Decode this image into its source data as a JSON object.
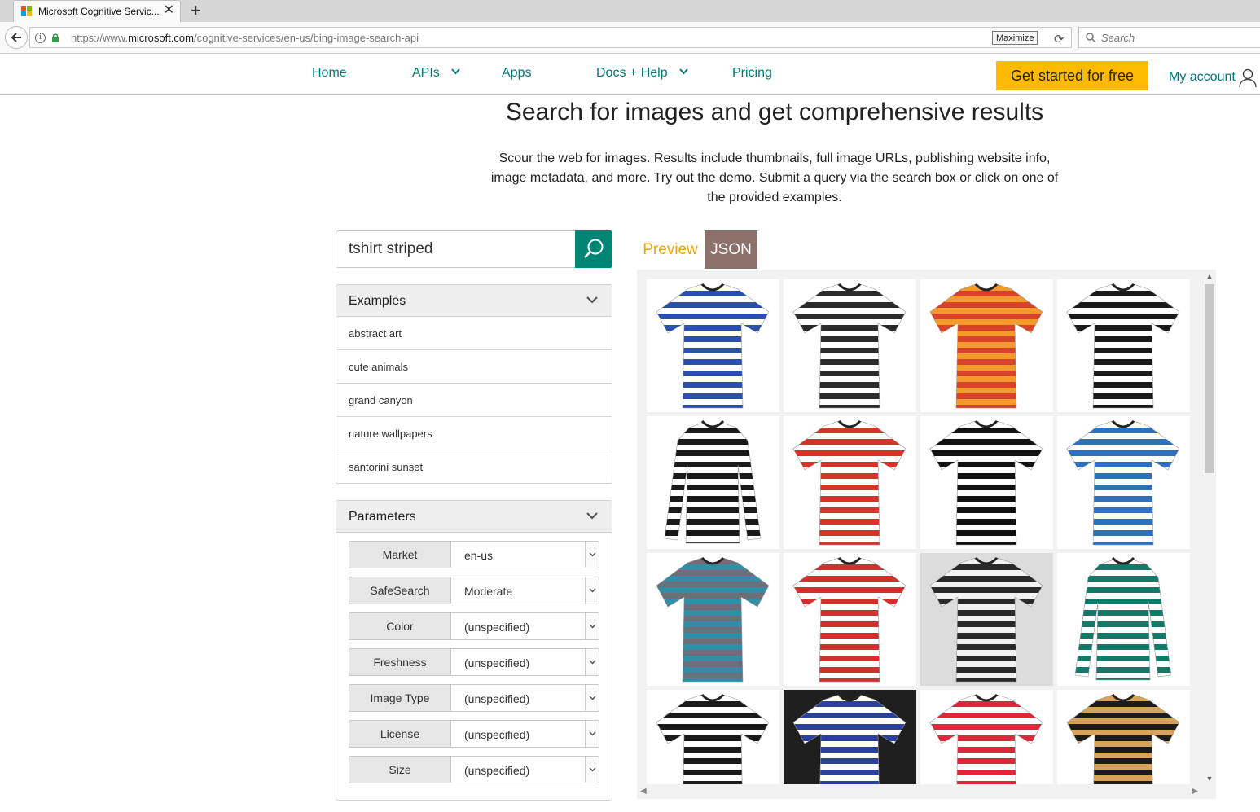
{
  "browser": {
    "tab_title": "Microsoft Cognitive Servic...",
    "new_tab_symbol": "+",
    "close_symbol": "✕",
    "url_prefix": "https://www.",
    "url_domain": "microsoft.com",
    "url_path": "/cognitive-services/en-us/bing-image-search-api",
    "tooltip": "Maximize",
    "search_placeholder": "Search"
  },
  "nav": {
    "home": "Home",
    "apis": "APIs",
    "apps": "Apps",
    "docs": "Docs + Help",
    "pricing": "Pricing",
    "cta": "Get started for free",
    "account": "My account"
  },
  "hero": {
    "title": "Search for images and get comprehensive results",
    "description": "Scour the web for images. Results include thumbnails, full image URLs, publishing website info, image metadata, and more. Try out the demo. Submit a query via the search box or click on one of the provided examples."
  },
  "query": {
    "value": "tshirt striped"
  },
  "examples": {
    "heading": "Examples",
    "items": [
      "abstract art",
      "cute animals",
      "grand canyon",
      "nature wallpapers",
      "santorini sunset"
    ]
  },
  "parameters": {
    "heading": "Parameters",
    "rows": [
      {
        "label": "Market",
        "value": "en-us"
      },
      {
        "label": "SafeSearch",
        "value": "Moderate"
      },
      {
        "label": "Color",
        "value": "(unspecified)"
      },
      {
        "label": "Freshness",
        "value": "(unspecified)"
      },
      {
        "label": "Image Type",
        "value": "(unspecified)"
      },
      {
        "label": "License",
        "value": "(unspecified)"
      },
      {
        "label": "Size",
        "value": "(unspecified)"
      }
    ]
  },
  "results": {
    "tabs": {
      "preview": "Preview",
      "json": "JSON"
    },
    "thumbnails": [
      {
        "icon": "striped-tshirt-blue-white",
        "stripe": "#2a4fb0",
        "base": "#ffffff",
        "shape": "short"
      },
      {
        "icon": "striped-tshirt-black-white",
        "stripe": "#2b2b2b",
        "base": "#ffffff",
        "shape": "short"
      },
      {
        "icon": "striped-tshirt-orange-red",
        "stripe": "#d8412a",
        "base": "#f39a2a",
        "shape": "short"
      },
      {
        "icon": "striped-tshirt-black-white",
        "stripe": "#1a1a1a",
        "base": "#ffffff",
        "shape": "short"
      },
      {
        "icon": "striped-longsleeve-black-white",
        "stripe": "#1a1a1a",
        "base": "#ffffff",
        "shape": "long"
      },
      {
        "icon": "striped-henley-red-white",
        "stripe": "#d8332b",
        "base": "#ffffff",
        "shape": "short"
      },
      {
        "icon": "striped-tshirt-black-white-wide",
        "stripe": "#111111",
        "base": "#ffffff",
        "shape": "short"
      },
      {
        "icon": "striped-tshirt-blue-white",
        "stripe": "#2e6fc0",
        "base": "#ffffff",
        "shape": "short"
      },
      {
        "icon": "striped-tshirt-teal-grey",
        "stripe": "#2f8fa5",
        "base": "#6a6f7a",
        "shape": "short"
      },
      {
        "icon": "striped-tshirt-red-white",
        "stripe": "#d32f2f",
        "base": "#ffffff",
        "shape": "short"
      },
      {
        "icon": "striped-tshirt-black-white",
        "stripe": "#2a2a2a",
        "base": "#f2f2f2",
        "shape": "short"
      },
      {
        "icon": "striped-longsleeve-green-white",
        "stripe": "#137a6a",
        "base": "#ffffff",
        "shape": "long"
      },
      {
        "icon": "striped-tshirt-black-white",
        "stripe": "#1a1a1a",
        "base": "#ffffff",
        "shape": "short"
      },
      {
        "icon": "striped-tshirt-blue-white",
        "stripe": "#2a3f9e",
        "base": "#ffffff",
        "shape": "short"
      },
      {
        "icon": "striped-tshirt-red-white",
        "stripe": "#e0263a",
        "base": "#ffffff",
        "shape": "short"
      },
      {
        "icon": "striped-tshirt-tan-black",
        "stripe": "#1c1c1c",
        "base": "#d8a25a",
        "shape": "short"
      }
    ]
  },
  "colors": {
    "nav_link": "#007a78",
    "cta": "#ffb900",
    "search_button": "#008575",
    "preview_tab": "#f0a30a",
    "json_tab": "#8c716b"
  }
}
